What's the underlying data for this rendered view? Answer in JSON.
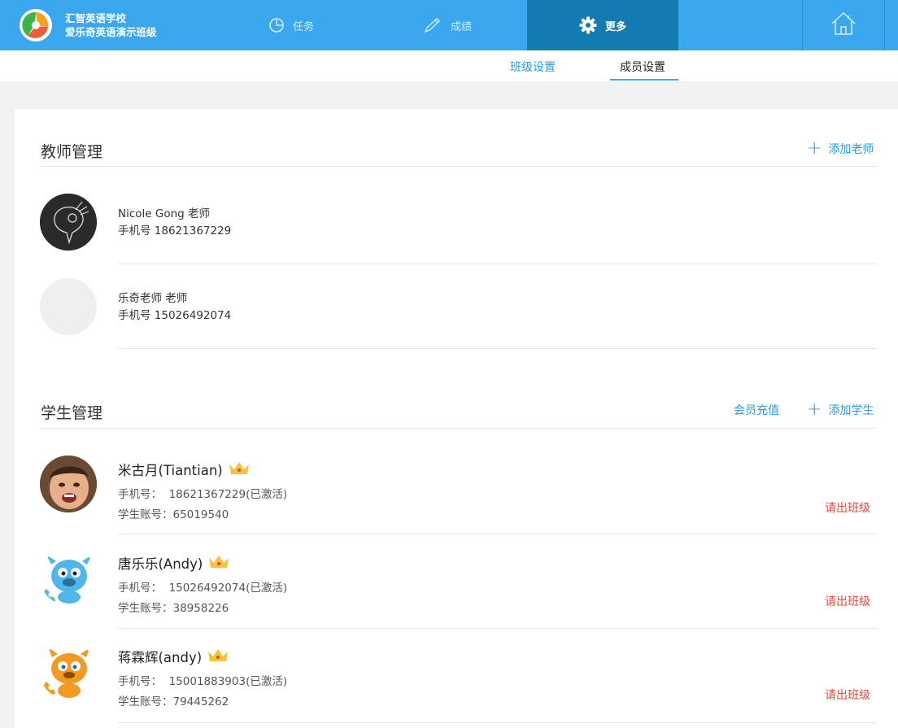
{
  "header": {
    "school": "汇智英语学校",
    "class_name": "爱乐奇英语演示班级",
    "nav": {
      "tasks": "任务",
      "scores": "成绩",
      "more": "更多"
    }
  },
  "subtabs": {
    "class_settings": "班级设置",
    "member_settings": "成员设置"
  },
  "teachers_section": {
    "title": "教师管理",
    "add_label": "添加老师",
    "teachers": [
      {
        "name": "Nicole Gong 老师",
        "phone": "手机号 18621367229"
      },
      {
        "name": "乐奇老师 老师",
        "phone": "手机号 15026492074"
      }
    ]
  },
  "students_section": {
    "title": "学生管理",
    "recharge_label": "会员充值",
    "add_label": "添加学生",
    "students": [
      {
        "name": "米古月(Tiantian)",
        "phone_label": "手机号：",
        "phone": "18621367229(已激活)",
        "account": "学生账号：65019540",
        "kick": "请出班级"
      },
      {
        "name": "唐乐乐(Andy)",
        "phone_label": "手机号：",
        "phone": "15026492074(已激活)",
        "account": "学生账号：38958226",
        "kick": "请出班级"
      },
      {
        "name": "蒋霖辉(andy)",
        "phone_label": "手机号：",
        "phone": "15001883903(已激活)",
        "account": "学生账号：79445262",
        "kick": "请出班级"
      }
    ]
  },
  "colors": {
    "primary": "#3aa7ee",
    "nav_active": "#137bb0",
    "link": "#2b9ae0",
    "danger": "#e64c3c"
  }
}
